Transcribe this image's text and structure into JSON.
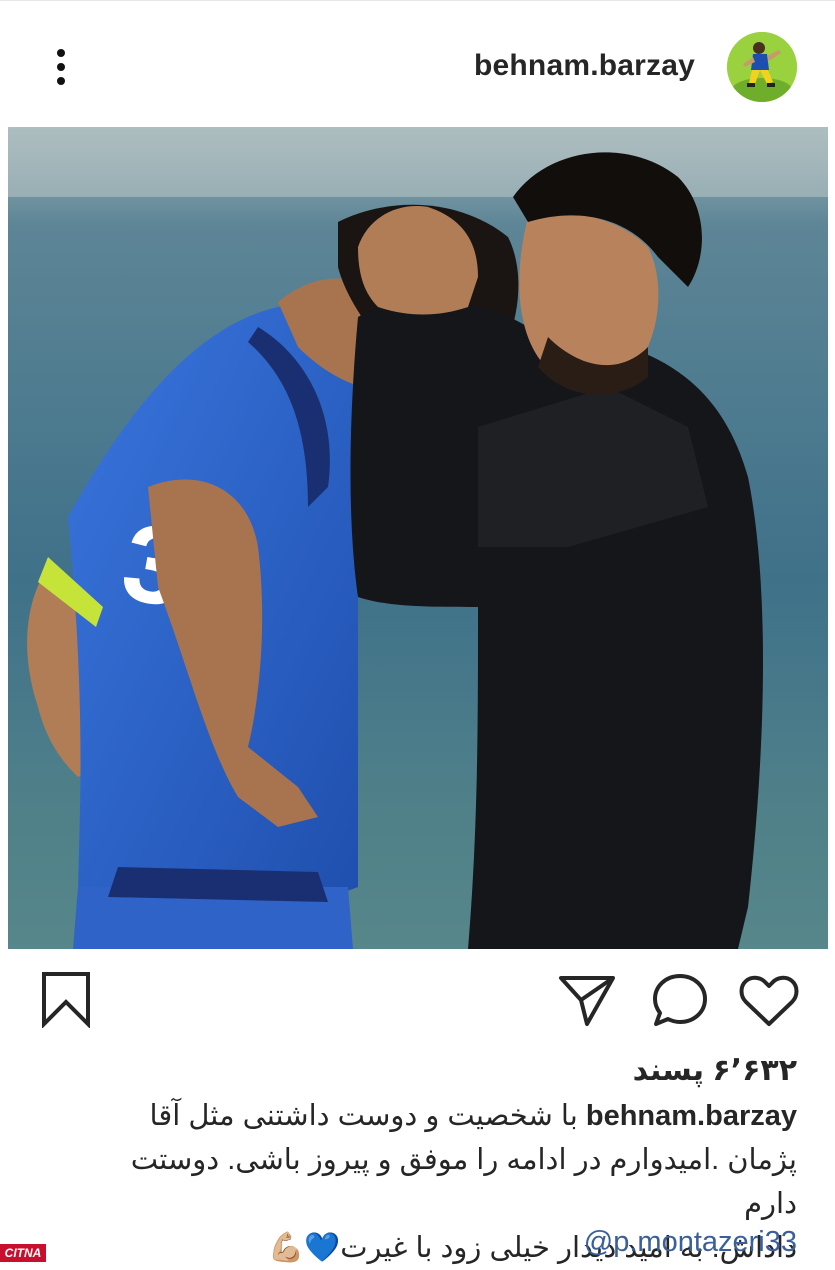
{
  "post": {
    "username": "behnam.barzay",
    "likes": "۶٬۶۳۲ پسند",
    "caption_user": "behnam.barzay",
    "caption_line1": " با شخصیت و دوست داشتنی مثل آقا",
    "caption_line2": "پژمان .امیدوارم در ادامه را موفق و پیروز باشی. دوستت دارم",
    "caption_line3": "داداش. به امید دیدار خیلی زود با غیرت💙💪🏼",
    "mention": "@p.montazeri33"
  },
  "icons": {
    "more": "more-vertical-icon",
    "bookmark": "bookmark-icon",
    "share": "send-icon",
    "comment": "comment-icon",
    "like": "heart-icon"
  },
  "watermark": "CITNA",
  "colors": {
    "text": "#262626",
    "mention": "#3a5f9b",
    "jersey_blue": "#2f63c8",
    "watermark_red": "#c8102e"
  }
}
